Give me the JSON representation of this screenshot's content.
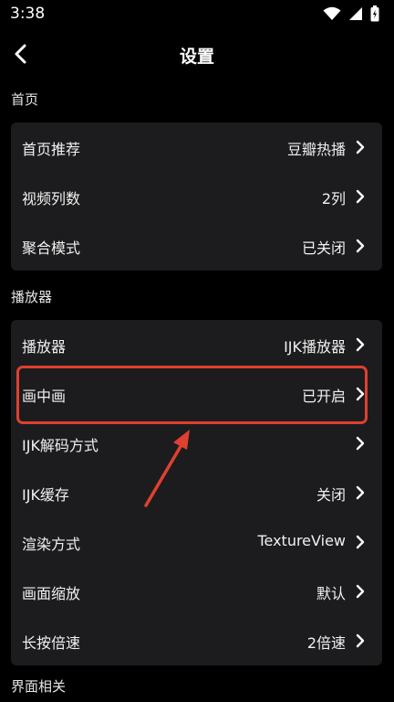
{
  "status_bar": {
    "time": "3:38",
    "icons": [
      "wifi-icon",
      "signal-icon",
      "battery-icon"
    ]
  },
  "header": {
    "title": "设置",
    "back_icon": "chevron-left-icon"
  },
  "sections": [
    {
      "title": "首页",
      "items": [
        {
          "label": "首页推荐",
          "value": "豆瓣热播"
        },
        {
          "label": "视频列数",
          "value": "2列"
        },
        {
          "label": "聚合模式",
          "value": "已关闭"
        }
      ]
    },
    {
      "title": "播放器",
      "items": [
        {
          "label": "播放器",
          "value": "IJK播放器"
        },
        {
          "label": "画中画",
          "value": "已开启"
        },
        {
          "label": "IJK解码方式",
          "value": ""
        },
        {
          "label": "IJK缓存",
          "value": "关闭"
        },
        {
          "label": "渲染方式",
          "value": "TextureView"
        },
        {
          "label": "画面缩放",
          "value": "默认"
        },
        {
          "label": "长按倍速",
          "value": "2倍速"
        }
      ]
    },
    {
      "title": "界面相关"
    }
  ],
  "annotation": {
    "highlight_color": "#e0402f",
    "highlighted_item": "画中画"
  },
  "colors": {
    "background": "#000000",
    "card": "#1c1c1e",
    "text": "#f0f0f0"
  }
}
